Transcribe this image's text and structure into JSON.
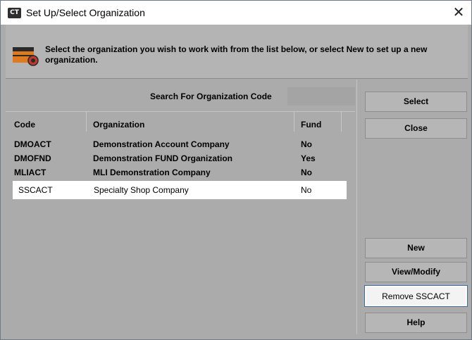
{
  "window": {
    "title": "Set Up/Select Organization",
    "app_badge": "CT",
    "close_glyph": "✕"
  },
  "header": {
    "icon": "organization-setup-icon",
    "message": "Select the organization you wish to work with from the list below, or select New to set up a new organization."
  },
  "search": {
    "label": "Search For Organization Code",
    "value": ""
  },
  "table": {
    "columns": [
      "Code",
      "Organization",
      "Fund"
    ],
    "rows": [
      {
        "code": "DMOACT",
        "organization": "Demonstration Account Company",
        "fund": "No"
      },
      {
        "code": "DMOFND",
        "organization": "Demonstration FUND Organization",
        "fund": "Yes"
      },
      {
        "code": "MLIACT",
        "organization": "MLI Demonstration Company",
        "fund": "No"
      },
      {
        "code": "SSCACT",
        "organization": "Specialty Shop Company",
        "fund": "No"
      }
    ],
    "selected_index": 3
  },
  "buttons": {
    "select": "Select",
    "close": "Close",
    "new": "New",
    "view_modify": "View/Modify",
    "remove": "Remove SSCACT",
    "help": "Help"
  },
  "colors": {
    "panel": "#ababab",
    "selected_row": "#ffffff",
    "focus_border": "#3a6ea5"
  }
}
